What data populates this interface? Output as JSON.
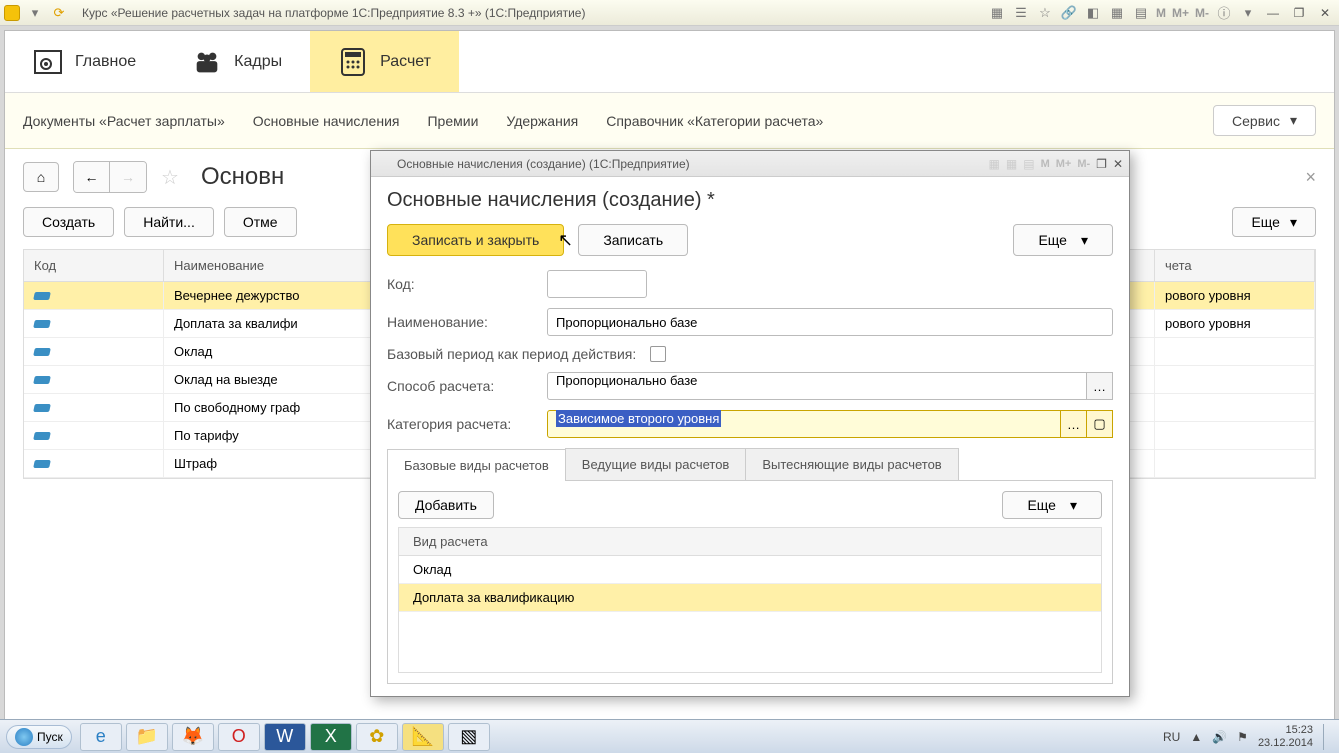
{
  "titlebar": {
    "title": "Курс «Решение расчетных задач на платформе 1С:Предприятие 8.3 +»  (1С:Предприятие)"
  },
  "mainTabs": {
    "home": "Главное",
    "hr": "Кадры",
    "calc": "Расчет"
  },
  "subnav": {
    "docs": "Документы «Расчет зарплаты»",
    "basic": "Основные начисления",
    "bonuses": "Премии",
    "deductions": "Удержания",
    "catalog": "Справочник «Категории расчета»",
    "service": "Сервис"
  },
  "page": {
    "title": "Основн",
    "create": "Создать",
    "find": "Найти...",
    "cancel": "Отме",
    "more": "Еще"
  },
  "bgTable": {
    "col1": "Код",
    "col2": "Наименование",
    "col3": "чета",
    "rows": [
      {
        "name": "Вечернее дежурство",
        "cat": "рового уровня"
      },
      {
        "name": "Доплата за квалифи",
        "cat": "рового уровня"
      },
      {
        "name": "Оклад",
        "cat": ""
      },
      {
        "name": "Оклад на выезде",
        "cat": ""
      },
      {
        "name": "По свободному граф",
        "cat": ""
      },
      {
        "name": "По тарифу",
        "cat": ""
      },
      {
        "name": "Штраф",
        "cat": ""
      }
    ]
  },
  "modal": {
    "windowTitle": "Основные начисления (создание)  (1С:Предприятие)",
    "heading": "Основные начисления (создание) *",
    "saveClose": "Записать и закрыть",
    "save": "Записать",
    "more": "Еще",
    "fields": {
      "codeLabel": "Код:",
      "codeValue": "",
      "nameLabel": "Наименование:",
      "nameValue": "Пропорционально базе",
      "basePeriodLabel": "Базовый период как период действия:",
      "methodLabel": "Способ расчета:",
      "methodValue": "Пропорционально базе",
      "categoryLabel": "Категория расчета:",
      "categoryValue": "Зависимое второго уровня"
    },
    "tabs": {
      "t1": "Базовые виды расчетов",
      "t2": "Ведущие виды расчетов",
      "t3": "Вытесняющие виды расчетов"
    },
    "tabContent": {
      "add": "Добавить",
      "more": "Еще",
      "header": "Вид расчета",
      "rows": [
        "Оклад",
        "Доплата за квалификацию"
      ]
    }
  },
  "taskbar": {
    "start": "Пуск",
    "lang": "RU",
    "time": "15:23",
    "date": "23.12.2014"
  }
}
